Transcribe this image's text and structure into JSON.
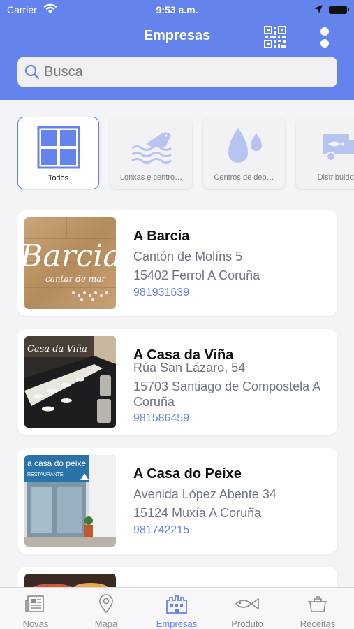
{
  "status_bar": {
    "carrier": "Carrier",
    "time": "9:53 a.m."
  },
  "header": {
    "title": "Empresas"
  },
  "search": {
    "placeholder": "Busca",
    "value": ""
  },
  "categories": [
    {
      "label": "Todos",
      "icon": "grid-icon",
      "selected": true
    },
    {
      "label": "Lonxas e centro…",
      "icon": "fish-market-icon",
      "selected": false
    },
    {
      "label": "Centros de dep…",
      "icon": "water-drops-icon",
      "selected": false
    },
    {
      "label": "Distribuidor",
      "icon": "delivery-truck-icon",
      "selected": false
    }
  ],
  "companies": [
    {
      "name": "A Barcia",
      "address1": "Cantón de Molíns 5",
      "address2": "15402 Ferrol A Coruña",
      "phone": "981931639",
      "image": "restaurant-sign-photo",
      "sign_text": "Barcia",
      "sign_sub": "cantar de mar"
    },
    {
      "name": "A Casa da Viña",
      "address1": "Rúa San Lázaro, 54",
      "address2": "15703 Santiago de Compostela A Coruña",
      "phone": "981586459",
      "image": "dining-room-photo",
      "sign_text": "Casa da Viña"
    },
    {
      "name": "A Casa do Peixe",
      "address1": "Avenida López Abente 34",
      "address2": "15124 Muxía A Coruña",
      "phone": "981742215",
      "image": "storefront-photo",
      "sign_text": "a casa do peixe",
      "sign_sub": "RESTAURANTE"
    }
  ],
  "tabs": [
    {
      "label": "Novas",
      "icon": "newspaper-icon",
      "active": false
    },
    {
      "label": "Mapa",
      "icon": "map-pin-icon",
      "active": false
    },
    {
      "label": "Empresas",
      "icon": "buildings-icon",
      "active": true
    },
    {
      "label": "Produto",
      "icon": "fish-icon",
      "active": false
    },
    {
      "label": "Receitas",
      "icon": "cooking-pot-icon",
      "active": false
    }
  ],
  "colors": {
    "accent": "#6583ed",
    "icon_muted": "#b7c4ef",
    "text_secondary": "#6f7683"
  }
}
